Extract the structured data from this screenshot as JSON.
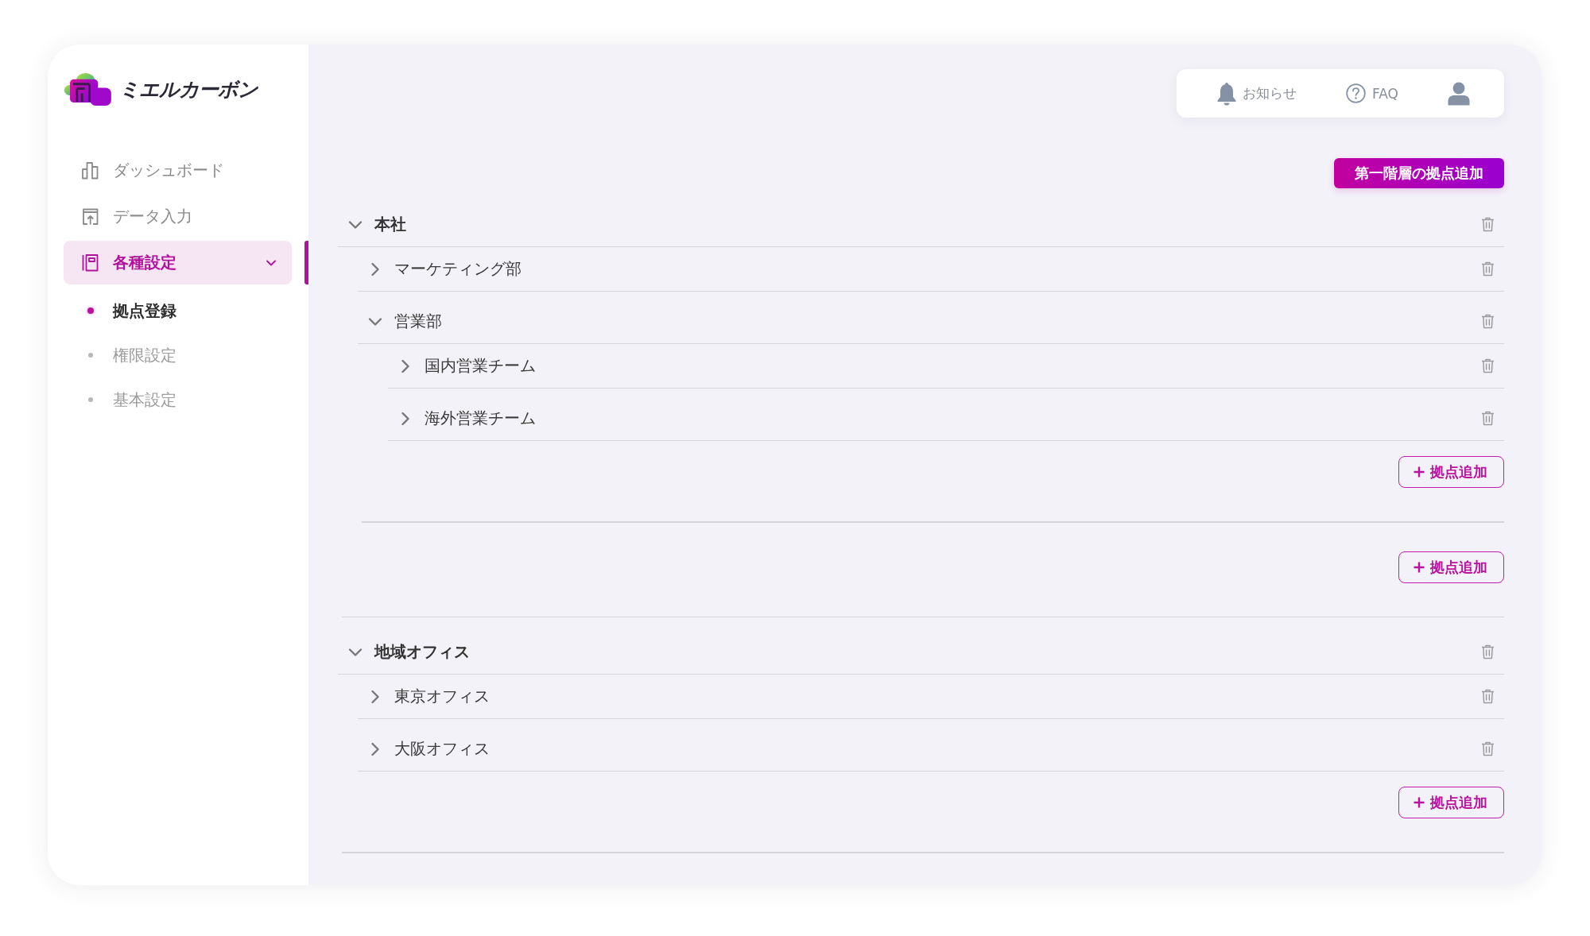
{
  "brand": {
    "name": "ミエルカーボン"
  },
  "sidebar": {
    "items": [
      {
        "label": "ダッシュボード",
        "selected": false
      },
      {
        "label": "データ入力",
        "selected": false
      },
      {
        "label": "各種設定",
        "selected": true,
        "expanded": true,
        "children": [
          {
            "label": "拠点登録",
            "selected": true
          },
          {
            "label": "権限設定",
            "selected": false
          },
          {
            "label": "基本設定",
            "selected": false
          }
        ]
      }
    ]
  },
  "header": {
    "links": [
      {
        "label": "お知らせ"
      },
      {
        "label": "FAQ"
      }
    ]
  },
  "toolbar": {
    "primary_button": "第一階層の拠点追加"
  },
  "tree": {
    "nodes": [
      {
        "label": "本社",
        "expanded": true,
        "add_button": "拠点追加",
        "children": [
          {
            "label": "マーケティング部",
            "expanded": false
          },
          {
            "label": "営業部",
            "expanded": true,
            "add_button": "拠点追加",
            "children": [
              {
                "label": "国内営業チーム",
                "expanded": false
              },
              {
                "label": "海外営業チーム",
                "expanded": false
              }
            ]
          }
        ]
      },
      {
        "label": "地域オフィス",
        "expanded": true,
        "add_button": "拠点追加",
        "children": [
          {
            "label": "東京オフィス",
            "expanded": false
          },
          {
            "label": "大阪オフィス",
            "expanded": false
          }
        ]
      }
    ]
  }
}
